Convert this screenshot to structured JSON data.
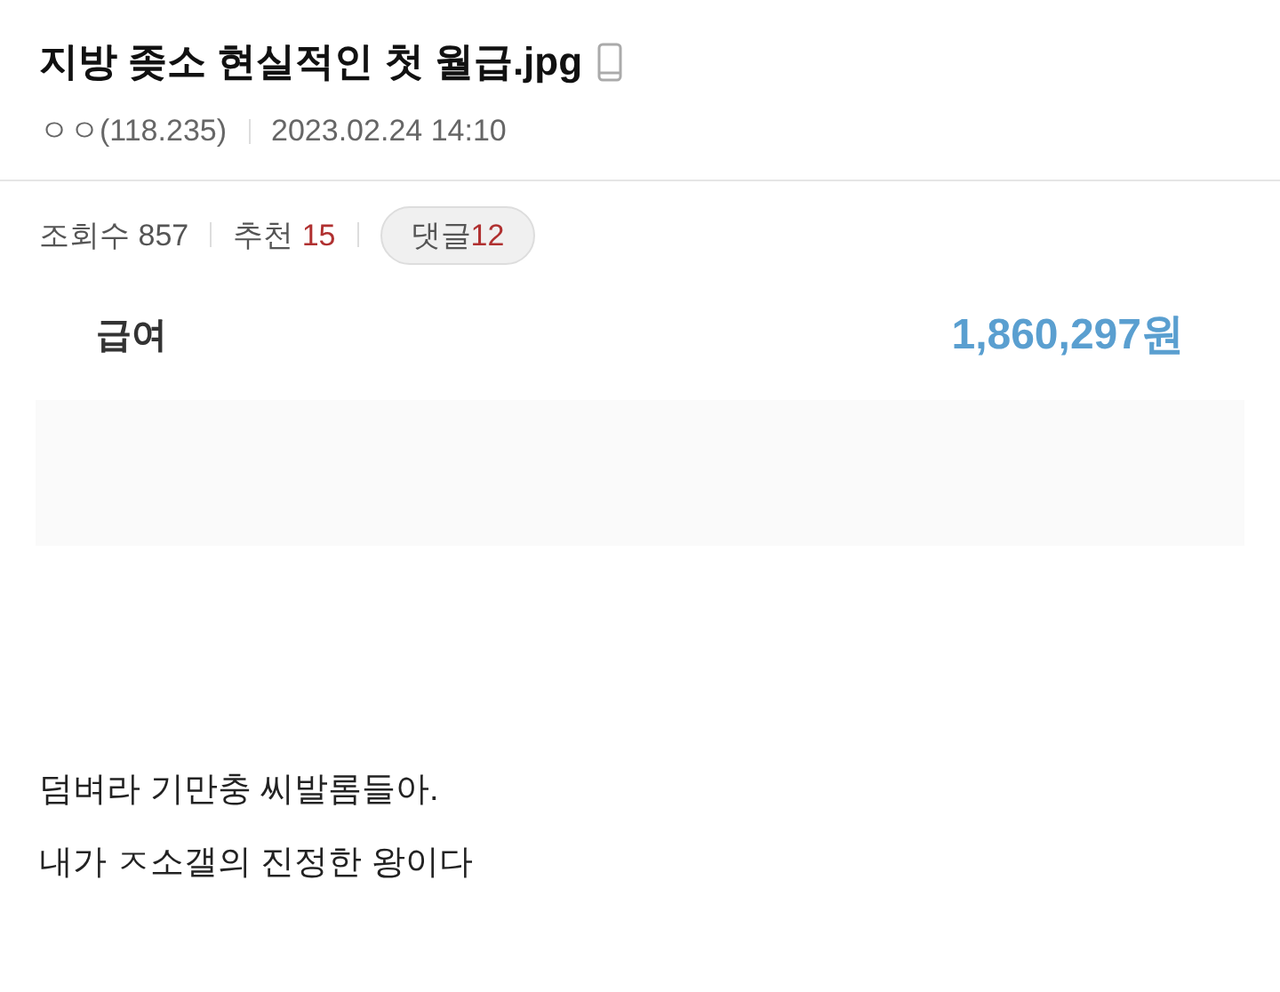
{
  "post": {
    "title": "지방 좆소 현실적인 첫 월급.jpg",
    "author": "ㅇㅇ(118.235)",
    "date": "2023.02.24 14:10"
  },
  "stats": {
    "views_label": "조회수",
    "views": "857",
    "likes_label": "추천",
    "likes": "15",
    "comments_label": "댓글",
    "comments": "12"
  },
  "salary": {
    "label": "급여",
    "amount": "1,860,297원"
  },
  "body": [
    "덤벼라 기만충 씨발롬들아.",
    "내가 ㅈ소갤의 진정한 왕이다"
  ]
}
